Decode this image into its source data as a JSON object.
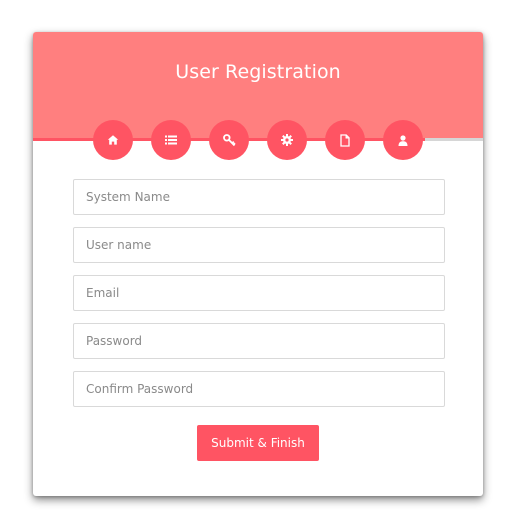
{
  "header": {
    "title": "User Registration",
    "background": "#ff7f7f"
  },
  "steps": {
    "progress": 0.87,
    "accent": "#ff5463",
    "items": [
      {
        "name": "home-icon"
      },
      {
        "name": "list-icon"
      },
      {
        "name": "key-icon"
      },
      {
        "name": "gear-icon"
      },
      {
        "name": "document-icon"
      },
      {
        "name": "user-icon"
      }
    ]
  },
  "form": {
    "system_name": {
      "value": "",
      "placeholder": "System Name"
    },
    "user_name": {
      "value": "",
      "placeholder": "User name"
    },
    "email": {
      "value": "",
      "placeholder": "Email"
    },
    "password": {
      "value": "",
      "placeholder": "Password"
    },
    "confirm_password": {
      "value": "",
      "placeholder": "Confirm Password"
    },
    "submit_label": "Submit & Finish"
  }
}
